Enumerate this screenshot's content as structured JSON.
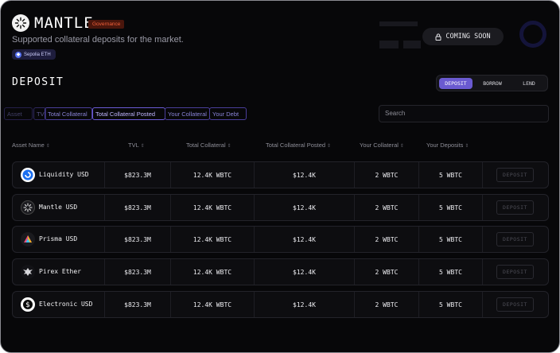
{
  "header": {
    "title": "MANTLE",
    "badge": "Governance",
    "subtitle": "Supported collateral deposits for the market.",
    "network_chip": "Sepolia ETH",
    "coming_soon": "COMING SOON"
  },
  "section_title": "DEPOSIT",
  "mode_toggle": {
    "options": [
      "DEPOSIT",
      "BORROW",
      "LEND"
    ],
    "selected": "DEPOSIT"
  },
  "filter_tabs": [
    "Asset",
    "TVL",
    "Total Collateral",
    "Total Collateral Posted",
    "Your Collateral",
    "Your Debt"
  ],
  "search": {
    "placeholder": "Search"
  },
  "columns": [
    "Asset Name",
    "TVL",
    "Total Collateral",
    "Total Collateral Posted",
    "Your Collateral",
    "Your Deposits"
  ],
  "rows": [
    {
      "asset": "Liquidity USD",
      "icon": "liquidity-usd-icon",
      "tvl": "$823.3M",
      "total_collateral": "12.4K WBTC",
      "total_posted": "$12.4K",
      "your_collateral": "2 WBTC",
      "your_deposits": "5 WBTC",
      "action": "DEPOSIT"
    },
    {
      "asset": "Mantle USD",
      "icon": "mantle-usd-icon",
      "tvl": "$823.3M",
      "total_collateral": "12.4K WBTC",
      "total_posted": "$12.4K",
      "your_collateral": "2 WBTC",
      "your_deposits": "5 WBTC",
      "action": "DEPOSIT"
    },
    {
      "asset": "Prisma USD",
      "icon": "prisma-usd-icon",
      "tvl": "$823.3M",
      "total_collateral": "12.4K WBTC",
      "total_posted": "$12.4K",
      "your_collateral": "2 WBTC",
      "your_deposits": "5 WBTC",
      "action": "DEPOSIT"
    },
    {
      "asset": "Pirex Ether",
      "icon": "pirex-ether-icon",
      "tvl": "$823.3M",
      "total_collateral": "12.4K WBTC",
      "total_posted": "$12.4K",
      "your_collateral": "2 WBTC",
      "your_deposits": "5 WBTC",
      "action": "DEPOSIT"
    },
    {
      "asset": "Electronic USD",
      "icon": "electronic-usd-icon",
      "tvl": "$823.3M",
      "total_collateral": "12.4K WBTC",
      "total_posted": "$12.4K",
      "your_collateral": "2 WBTC",
      "your_deposits": "5 WBTC",
      "action": "DEPOSIT"
    }
  ],
  "colors": {
    "accent": "#6a5ad0",
    "badge_bg": "#4a160c",
    "badge_text": "#f0603a",
    "background": "#070709"
  }
}
